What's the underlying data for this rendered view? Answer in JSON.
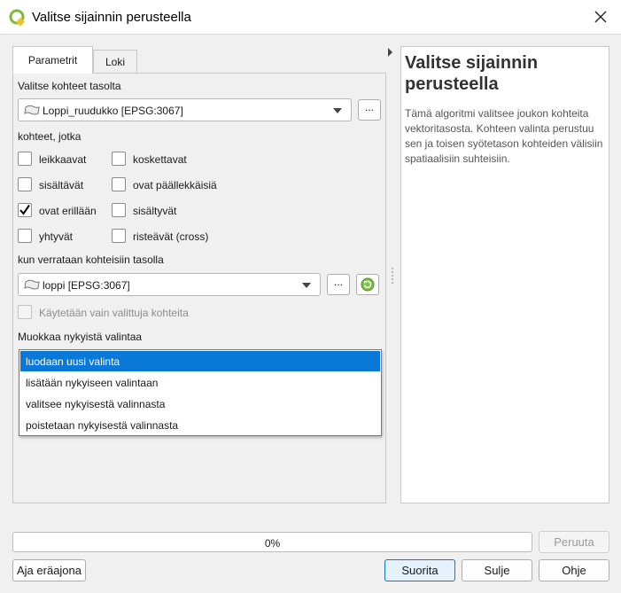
{
  "window": {
    "title": "Valitse sijainnin perusteella",
    "app_icon": "qgis-icon",
    "close_icon": "close-icon"
  },
  "tabs": [
    {
      "label": "Parametrit",
      "active": true
    },
    {
      "label": "Loki",
      "active": false
    }
  ],
  "params": {
    "source_label": "Valitse kohteet tasolta",
    "source_layer": "Loppi_ruudukko [EPSG:3067]",
    "predicate_label": "kohteet, jotka",
    "predicates": [
      {
        "label": "leikkaavat",
        "checked": false
      },
      {
        "label": "koskettavat",
        "checked": false
      },
      {
        "label": "sisältävät",
        "checked": false
      },
      {
        "label": "ovat päällekkäisiä",
        "checked": false
      },
      {
        "label": "ovat erillään",
        "checked": true
      },
      {
        "label": "sisältyvät",
        "checked": false
      },
      {
        "label": "yhtyvät",
        "checked": false
      },
      {
        "label": "risteävät (cross)",
        "checked": false
      }
    ],
    "compare_label": "kun verrataan kohteisiin tasolla",
    "compare_layer": "loppi [EPSG:3067]",
    "selected_only_label": "Käytetään vain valittuja kohteita",
    "selected_only_checked": false,
    "method_label": "Muokkaa nykyistä valintaa",
    "method_options": [
      {
        "label": "luodaan uusi valinta",
        "selected": true
      },
      {
        "label": "lisätään nykyiseen valintaan",
        "selected": false
      },
      {
        "label": "valitsee nykyisestä valinnasta",
        "selected": false
      },
      {
        "label": "poistetaan nykyisestä valinnasta",
        "selected": false
      }
    ],
    "ellipsis": "..."
  },
  "help": {
    "title": "Valitse sijainnin perusteella",
    "text": "Tämä algoritmi valitsee joukon kohteita vektoritasosta. Kohteen valinta perustuu sen ja toisen syötetason kohteiden välisiin spatiaalisiin suhteisiin."
  },
  "progress": {
    "text": "0%",
    "value": 0
  },
  "buttons": {
    "cancel": "Peruuta",
    "batch": "Aja eräajona",
    "run": "Suorita",
    "close": "Sulje",
    "help": "Ohje"
  },
  "colors": {
    "accent": "#0a78d7",
    "check": "#000000"
  }
}
